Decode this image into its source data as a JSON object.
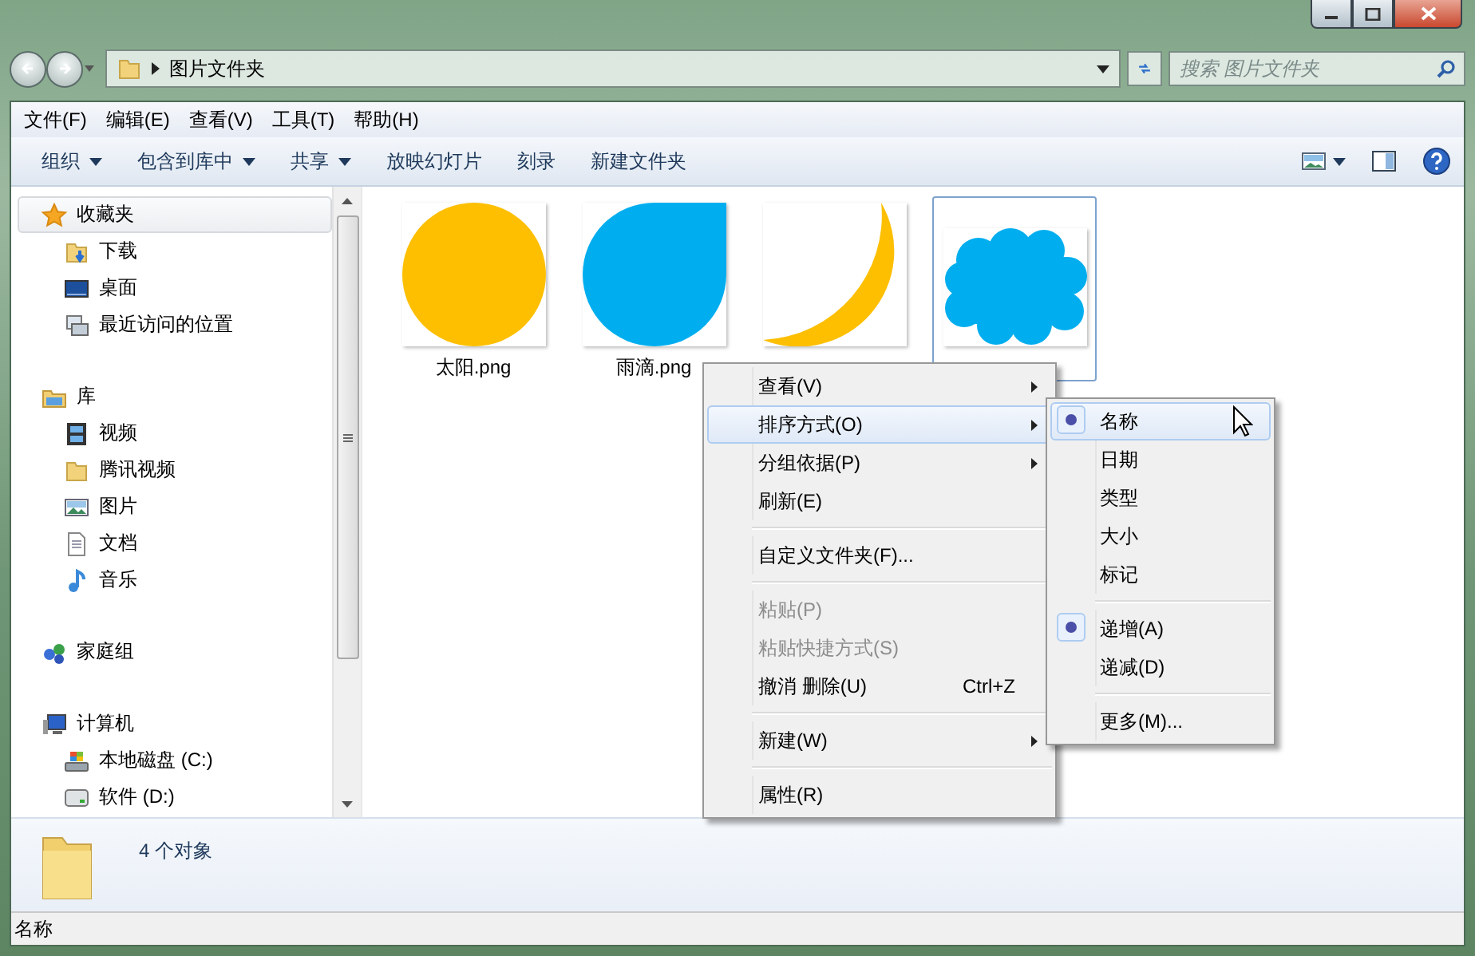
{
  "address": {
    "path": "图片文件夹"
  },
  "search": {
    "placeholder": "搜索 图片文件夹"
  },
  "menu_bar": [
    "文件(F)",
    "编辑(E)",
    "查看(V)",
    "工具(T)",
    "帮助(H)"
  ],
  "toolbar": [
    {
      "label": "组织",
      "dropdown": true
    },
    {
      "label": "包含到库中",
      "dropdown": true
    },
    {
      "label": "共享",
      "dropdown": true
    },
    {
      "label": "放映幻灯片",
      "dropdown": false
    },
    {
      "label": "刻录",
      "dropdown": false
    },
    {
      "label": "新建文件夹",
      "dropdown": false
    }
  ],
  "sidebar": {
    "groups": [
      {
        "label": "收藏夹",
        "selected": true,
        "children": [
          {
            "label": "下载"
          },
          {
            "label": "桌面"
          },
          {
            "label": "最近访问的位置"
          }
        ]
      },
      {
        "label": "库",
        "selected": false,
        "children": [
          {
            "label": "视频"
          },
          {
            "label": "腾讯视频"
          },
          {
            "label": "图片"
          },
          {
            "label": "文档"
          },
          {
            "label": "音乐"
          }
        ]
      },
      {
        "label": "家庭组",
        "selected": false
      },
      {
        "label": "计算机",
        "selected": false,
        "children": [
          {
            "label": "本地磁盘 (C:)"
          },
          {
            "label": "软件 (D:)"
          }
        ]
      }
    ]
  },
  "files": [
    {
      "name": "太阳.png",
      "kind": "sun",
      "selected": false
    },
    {
      "name": "雨滴.png",
      "kind": "drop",
      "selected": false
    },
    {
      "kind": "moon",
      "selected": false
    },
    {
      "kind": "cloud",
      "selected": true
    }
  ],
  "details": {
    "count": "4 个对象"
  },
  "status_bar": {
    "text": "名称"
  },
  "context_menu": {
    "items": [
      {
        "kind": "item",
        "label": "查看(V)",
        "submenu": true,
        "disabled": false,
        "selected": false
      },
      {
        "kind": "item",
        "label": "排序方式(O)",
        "submenu": true,
        "disabled": false,
        "selected": true
      },
      {
        "kind": "item",
        "label": "分组依据(P)",
        "submenu": true,
        "disabled": false,
        "selected": false
      },
      {
        "kind": "item",
        "label": "刷新(E)",
        "submenu": false,
        "disabled": false,
        "selected": false
      },
      {
        "kind": "separator"
      },
      {
        "kind": "item",
        "label": "自定义文件夹(F)...",
        "submenu": false,
        "disabled": false,
        "selected": false
      },
      {
        "kind": "separator"
      },
      {
        "kind": "item",
        "label": "粘贴(P)",
        "submenu": false,
        "disabled": true,
        "selected": false
      },
      {
        "kind": "item",
        "label": "粘贴快捷方式(S)",
        "submenu": false,
        "disabled": true,
        "selected": false
      },
      {
        "kind": "item",
        "label": "撤消 删除(U)",
        "shortcut": "Ctrl+Z",
        "submenu": false,
        "disabled": false,
        "selected": false
      },
      {
        "kind": "separator"
      },
      {
        "kind": "item",
        "label": "新建(W)",
        "submenu": true,
        "disabled": false,
        "selected": false
      },
      {
        "kind": "separator"
      },
      {
        "kind": "item",
        "label": "属性(R)",
        "submenu": false,
        "disabled": false,
        "selected": false
      }
    ]
  },
  "submenu": {
    "items": [
      {
        "kind": "item",
        "label": "名称",
        "checked": true,
        "selected": true
      },
      {
        "kind": "item",
        "label": "日期",
        "checked": false,
        "selected": false
      },
      {
        "kind": "item",
        "label": "类型",
        "checked": false,
        "selected": false
      },
      {
        "kind": "item",
        "label": "大小",
        "checked": false,
        "selected": false
      },
      {
        "kind": "item",
        "label": "标记",
        "checked": false,
        "selected": false
      },
      {
        "kind": "separator"
      },
      {
        "kind": "item",
        "label": "递增(A)",
        "checked": true,
        "selected": false
      },
      {
        "kind": "item",
        "label": "递减(D)",
        "checked": false,
        "selected": false
      },
      {
        "kind": "separator"
      },
      {
        "kind": "item",
        "label": "更多(M)...",
        "checked": false,
        "selected": false
      }
    ]
  }
}
